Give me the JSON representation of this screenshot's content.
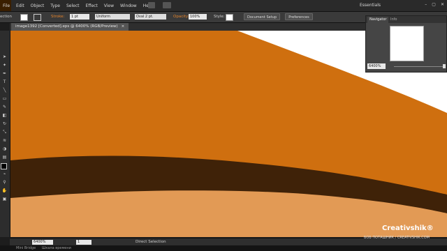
{
  "menubar": {
    "menus": [
      "File",
      "Edit",
      "Object",
      "Type",
      "Select",
      "Effect",
      "View",
      "Window",
      "Help"
    ],
    "workspace": "Essentials",
    "window_controls": [
      "–",
      "▢",
      "✕"
    ]
  },
  "control_bar": {
    "selection_label": "ection",
    "stroke_label": "Stroke:",
    "stroke_weight": "1 pt",
    "profile": "Uniform",
    "brush": "Oval 2 pt.",
    "opacity_label": "Opacity:",
    "opacity_value": "100%",
    "style_label": "Style:",
    "document_setup": "Document Setup",
    "preferences": "Preferences"
  },
  "document_tab": {
    "title": "image1392 [Converted].eps @ 6400% (RGB/Preview)",
    "close": "×"
  },
  "navigator": {
    "tabs": [
      "Navigator",
      "Info"
    ],
    "zoom": "6400%"
  },
  "status_bar": {
    "zoom": "6400%",
    "page": "1",
    "mode": "Direct Selection"
  },
  "taskbar": {
    "items": [
      "Mini Bridge",
      "Шкала времени"
    ]
  },
  "watermark": {
    "brand": "Creativshik®",
    "credit": "БОБ ПОТАШНИК / CREATIVSHIK.COM"
  },
  "colors": {
    "orange": "#cf6f0f",
    "dark_brown": "#3f2208",
    "light_orange": "#e29a55",
    "white": "#ffffff"
  },
  "icons": {
    "tools": [
      "selection-tool-icon",
      "direct-selection-tool-icon",
      "magic-wand-icon",
      "type-tool-icon",
      "rectangle-tool-icon",
      "pencil-tool-icon",
      "brush-tool-icon",
      "eraser-tool-icon",
      "rotate-tool-icon",
      "scale-tool-icon",
      "warp-tool-icon",
      "free-transform-icon",
      "shape-builder-icon",
      "perspective-grid-icon",
      "mesh-tool-icon",
      "gradient-tool-icon",
      "eyedropper-tool-icon",
      "blend-tool-icon",
      "symbol-sprayer-icon",
      "graph-tool-icon",
      "artboard-tool-icon",
      "slice-tool-icon",
      "hand-tool-icon",
      "zoom-tool-icon"
    ]
  }
}
